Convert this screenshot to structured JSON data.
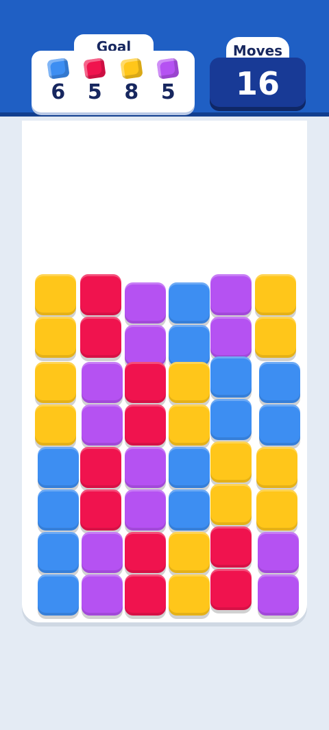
{
  "colors": {
    "blue": "#3d8ef2",
    "red": "#f0134e",
    "yellow": "#ffc61a",
    "purple": "#b552f2"
  },
  "goal": {
    "title": "Goal",
    "items": [
      {
        "color": "blue",
        "count": "6"
      },
      {
        "color": "red",
        "count": "5"
      },
      {
        "color": "yellow",
        "count": "8"
      },
      {
        "color": "purple",
        "count": "5"
      }
    ]
  },
  "moves": {
    "title": "Moves",
    "value": "16"
  },
  "board": {
    "rows": 8,
    "cols": 6,
    "grid": [
      [
        "yellow",
        "red",
        "purple",
        "blue",
        "purple",
        "yellow"
      ],
      [
        "yellow",
        "red",
        "purple",
        "blue",
        "purple",
        "yellow"
      ],
      [
        "yellow",
        "purple",
        "red",
        "yellow",
        "blue",
        "blue"
      ],
      [
        "yellow",
        "purple",
        "red",
        "yellow",
        "blue",
        "blue"
      ],
      [
        "blue",
        "red",
        "purple",
        "blue",
        "yellow",
        "yellow"
      ],
      [
        "blue",
        "red",
        "purple",
        "blue",
        "yellow",
        "yellow"
      ],
      [
        "blue",
        "purple",
        "red",
        "yellow",
        "red",
        "purple"
      ],
      [
        "blue",
        "purple",
        "red",
        "yellow",
        "red",
        "purple"
      ]
    ]
  }
}
